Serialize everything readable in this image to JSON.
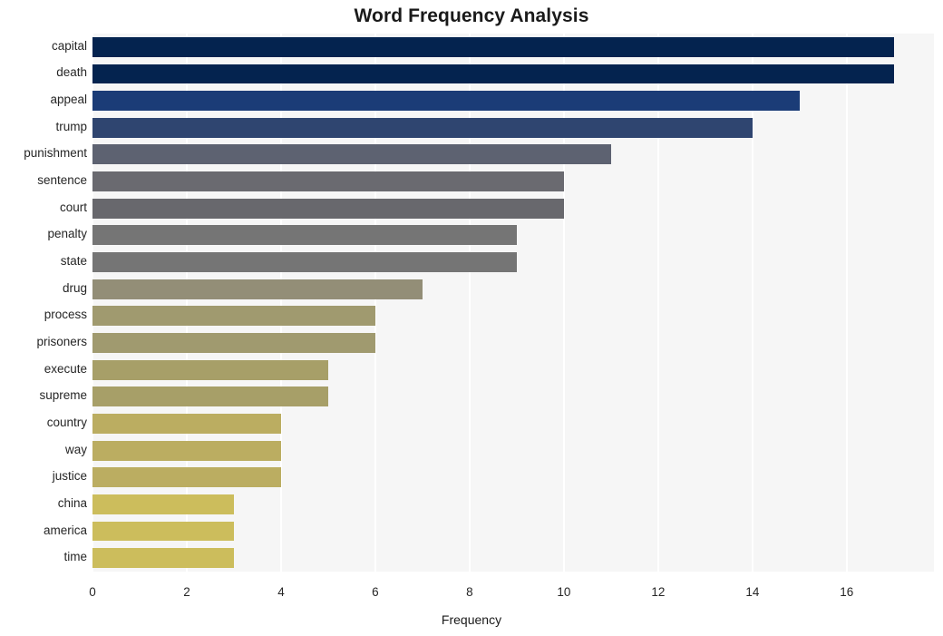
{
  "chart_data": {
    "type": "bar",
    "orientation": "horizontal",
    "title": "Word Frequency Analysis",
    "xlabel": "Frequency",
    "ylabel": "",
    "categories": [
      "capital",
      "death",
      "appeal",
      "trump",
      "punishment",
      "sentence",
      "court",
      "penalty",
      "state",
      "drug",
      "process",
      "prisoners",
      "execute",
      "supreme",
      "country",
      "way",
      "justice",
      "china",
      "america",
      "time"
    ],
    "values": [
      17,
      17,
      15,
      14,
      11,
      10,
      10,
      9,
      9,
      7,
      6,
      6,
      5,
      5,
      4,
      4,
      4,
      3,
      3,
      3
    ],
    "bar_colors": [
      "#04234f",
      "#04234f",
      "#1b3c77",
      "#2f4570",
      "#5d6271",
      "#6a6a70",
      "#68686d",
      "#757575",
      "#757575",
      "#938e77",
      "#a09a6f",
      "#a09a6f",
      "#a79f68",
      "#a79f68",
      "#bbad61",
      "#bbad61",
      "#bbad61",
      "#ccbd5c",
      "#ccbd5c",
      "#ccbd5c"
    ],
    "xlim": [
      0,
      17.85
    ],
    "ylim_categories": 20,
    "xticks": [
      0,
      2,
      4,
      6,
      8,
      10,
      12,
      14,
      16
    ],
    "xticklabels": [
      "0",
      "2",
      "4",
      "6",
      "8",
      "10",
      "12",
      "14",
      "16"
    ],
    "grid": "vertical-only",
    "grid_color": "#ffffff",
    "plot_background": "#f6f6f6",
    "figure_background": "#ffffff",
    "legend": "none"
  }
}
